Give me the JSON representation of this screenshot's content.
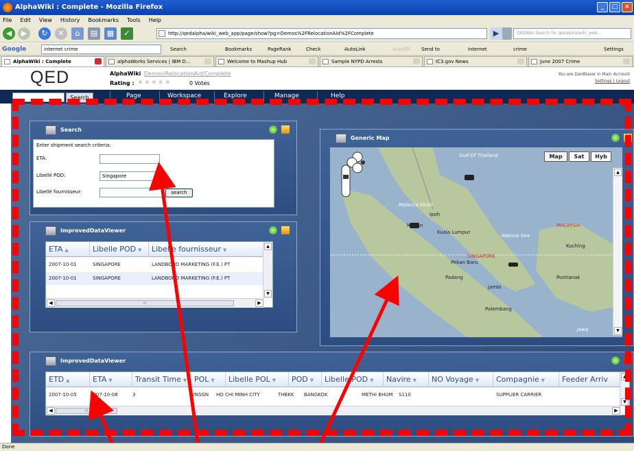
{
  "window": {
    "title": "AlphaWiki : Complete - Mozilla Firefox",
    "min": "_",
    "max": "□",
    "close": "×"
  },
  "menu": [
    "File",
    "Edit",
    "View",
    "History",
    "Bookmarks",
    "Tools",
    "Help"
  ],
  "nav": {
    "url": "http://qedalpha/wiki_web_app/page/show?pg=Demos%2FRelocationAid%2FComplete",
    "search_placeholder": "QEDWiki Search for qedalpha/wiki_web..."
  },
  "google_bar": {
    "logo": "Google",
    "query": "internet crime",
    "items": [
      "Search",
      "Bookmarks",
      "PageRank",
      "Check",
      "AutoLink",
      "AutoFill",
      "Send to",
      "internet",
      "crime",
      "Settings"
    ]
  },
  "tabs": [
    {
      "label": "AlphaWiki : Complete",
      "active": true
    },
    {
      "label": "alphaWorks Services | IBM D...",
      "active": false
    },
    {
      "label": "Welcome to Mashup Hub",
      "active": false
    },
    {
      "label": "Sample NYPD Arrests",
      "active": false
    },
    {
      "label": "IC3.gov News",
      "active": false
    },
    {
      "label": "June 2007 Crime",
      "active": false
    }
  ],
  "header": {
    "logo": "QED",
    "app": "AlphaWiki",
    "breadcrumb": "Demos/RelocationAid/Complete",
    "rating_label": "Rating :",
    "stars": "★★★★★",
    "votes": "0 Votes",
    "signed_in": "You are DanBlaser in Main Account",
    "links": "Settings | Logout"
  },
  "topnav": {
    "search_button": "Search",
    "items": [
      "Page",
      "Workspace",
      "Explore",
      "Manage",
      "Help"
    ]
  },
  "search_panel": {
    "title": "Search",
    "prompt": "Enter shipment search criteria:",
    "eta_label": "ETA:",
    "eta_value": "",
    "pod_label": "Libellé POD:",
    "pod_value": "Singapore",
    "supplier_label": "Libellé fournisseur:",
    "supplier_value": "",
    "search_button": "search"
  },
  "viewer1": {
    "title": "ImprovedDataViewer",
    "columns": [
      "ETA",
      "Libelle POD",
      "Libelle fournisseur"
    ],
    "rows": [
      [
        "2007-10-01",
        "SINGAPORE",
        "LANDBOND MARKETING (F.E.) PT"
      ],
      [
        "2007-10-01",
        "SINGAPORE",
        "LANDBOND MARKETING (F.E.) PT"
      ]
    ],
    "hscroll_label": "III"
  },
  "map_panel": {
    "title": "Generic Map",
    "buttons": [
      "Map",
      "Sat",
      "Hyb"
    ],
    "labels": {
      "gulf": "Gulf Of Thailand",
      "malacca": "Malacca Strait",
      "ipoh": "Ipoh",
      "medan": "Medan",
      "kl": "Kuala Lumpur",
      "malaysia": "MALAYSIA",
      "natuna": "Natuna Sea",
      "singapore": "SINGAPORE",
      "pekanbaru": "Pekan Baru",
      "kuching": "Kuching",
      "padang": "Padang",
      "pontianak": "Pontianak",
      "jambi": "Jambi",
      "palembang": "Palembang",
      "java": "Jawa"
    }
  },
  "viewer2": {
    "title": "ImprovedDataViewer",
    "columns": [
      "ETD",
      "ETA",
      "Transit Time",
      "POL",
      "Libelle POL",
      "POD",
      "Libelle POD",
      "Navire",
      "NO Voyage",
      "Compagnie",
      "Feeder Arriv"
    ],
    "row": [
      "2007-10-05",
      "2007-10-08",
      "3",
      "VNSGN",
      "HO CHI MINH CITY",
      "THBKK",
      "BANGKOK",
      "METHI BHUM",
      "S110",
      "SUPPLIER CARRIER",
      ""
    ],
    "hscroll_label": "III"
  },
  "status": "Done",
  "colors": {
    "annotation": "#ff0000",
    "workspace": "#3f5e8e",
    "navbar": "#0d2a55"
  }
}
